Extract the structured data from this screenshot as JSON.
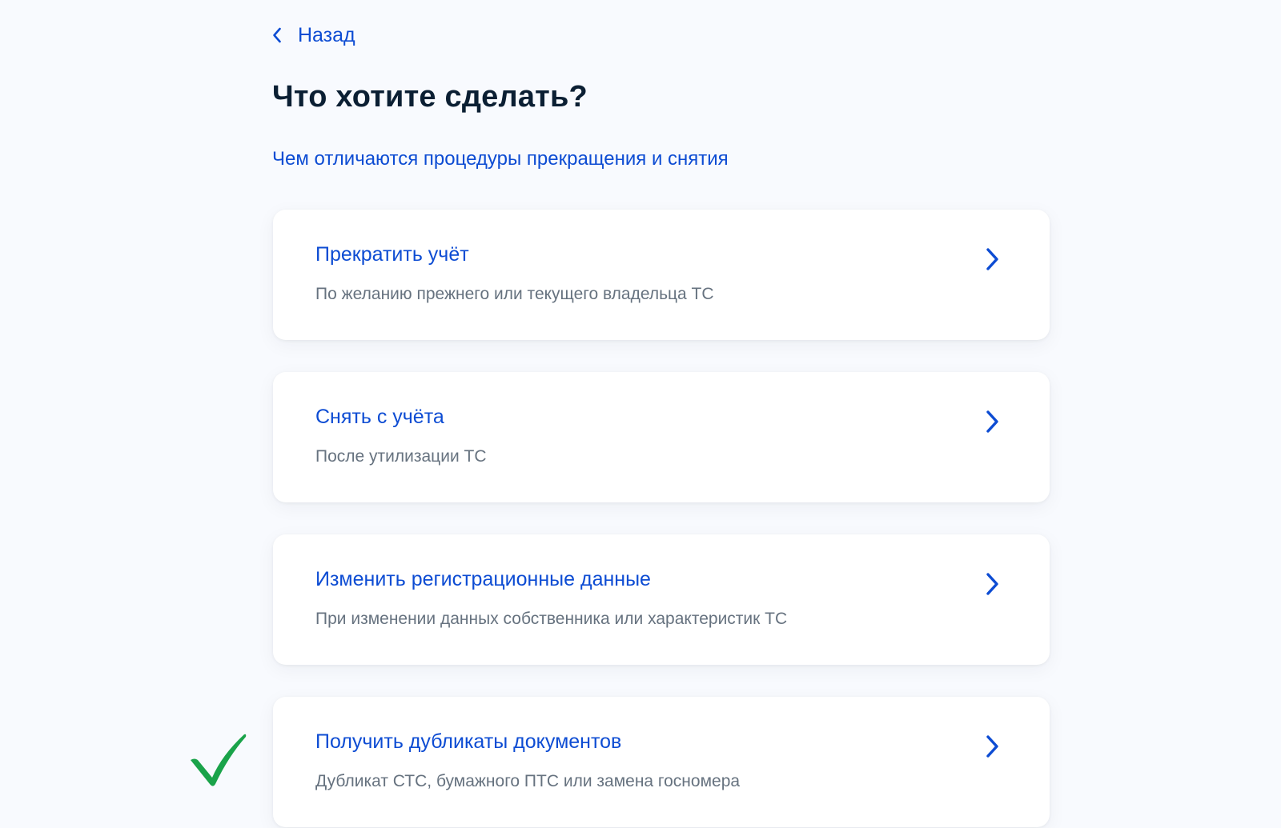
{
  "back": {
    "label": "Назад"
  },
  "title": "Что хотите сделать?",
  "info_link": "Чем отличаются процедуры прекращения и снятия",
  "options": [
    {
      "title": "Прекратить учёт",
      "description": "По желанию прежнего или текущего владельца ТС"
    },
    {
      "title": "Снять с учёта",
      "description": "После утилизации ТС"
    },
    {
      "title": "Изменить регистрационные данные",
      "description": "При изменении данных собственника или характеристик ТС"
    },
    {
      "title": "Получить дубликаты документов",
      "description": "Дубликат СТС, бумажного ПТС или замена госномера"
    }
  ],
  "colors": {
    "accent": "#0d4cd3",
    "heading": "#0b1f33",
    "secondary_text": "#66727f",
    "background": "#f8fafe",
    "checkmark": "#1aa34a"
  },
  "icons": {
    "back": "chevron-left-icon",
    "option_arrow": "chevron-right-icon",
    "selected_marker": "checkmark-icon"
  }
}
